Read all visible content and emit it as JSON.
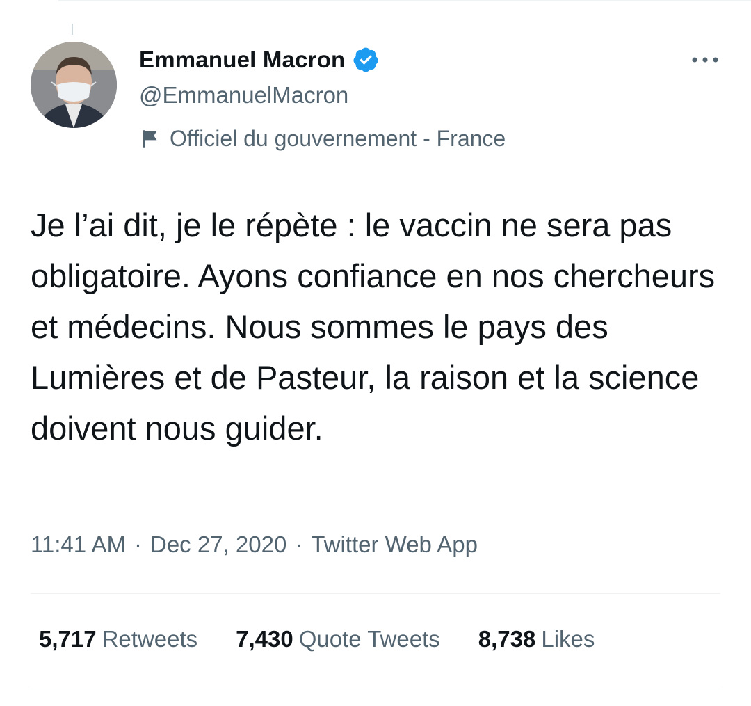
{
  "author": {
    "display_name": "Emmanuel Macron",
    "handle": "@EmmanuelMacron",
    "label": "Officiel du gouvernement - France",
    "verified": true
  },
  "tweet": {
    "text": "Je l’ai dit, je le répète : le vaccin ne sera pas obligatoire. Ayons confiance en nos chercheurs et médecins. Nous sommes le pays des Lumières et de Pasteur, la raison et la science doivent nous guider.",
    "time": "11:41 AM",
    "date": "Dec 27, 2020",
    "source": "Twitter Web App"
  },
  "stats": {
    "retweets": {
      "count": "5,717",
      "label": "Retweets"
    },
    "quotes": {
      "count": "7,430",
      "label": "Quote Tweets"
    },
    "likes": {
      "count": "8,738",
      "label": "Likes"
    }
  },
  "colors": {
    "verified": "#1d9bf0",
    "secondary_text": "#536471",
    "primary_text": "#0f1419"
  },
  "icons": {
    "verified": "verified-badge-icon",
    "flag": "flag-icon",
    "more": "more-dots-icon"
  }
}
